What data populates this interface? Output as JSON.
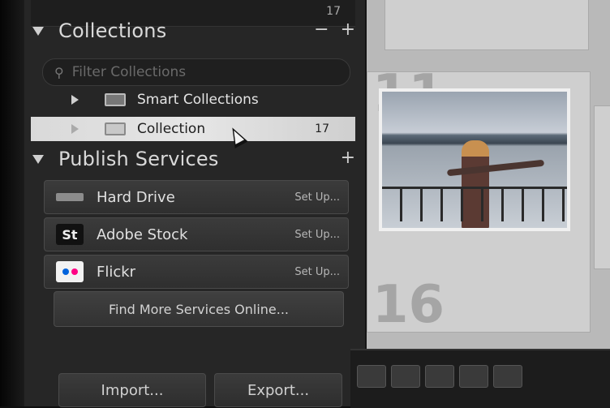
{
  "top_strip": {
    "count": "17"
  },
  "collections": {
    "title": "Collections",
    "minus": "−",
    "plus": "+",
    "filter_placeholder": "Filter Collections",
    "items": [
      {
        "label": "Smart Collections",
        "count": ""
      },
      {
        "label": "Collection",
        "count": "17"
      }
    ]
  },
  "publish": {
    "title": "Publish Services",
    "plus": "+",
    "services": [
      {
        "label": "Hard Drive",
        "action": "Set Up..."
      },
      {
        "label": "Adobe Stock",
        "action": "Set Up...",
        "icon_text": "St"
      },
      {
        "label": "Flickr",
        "action": "Set Up..."
      }
    ],
    "find_more": "Find More Services Online..."
  },
  "bottom_buttons": {
    "import": "Import...",
    "export": "Export..."
  },
  "grid": {
    "cell_numbers": [
      "11",
      "16"
    ]
  },
  "colors": {
    "selection": "#dcdcdc",
    "panel": "#262626",
    "flickr_blue": "#0063dc",
    "flickr_pink": "#ff0084"
  }
}
